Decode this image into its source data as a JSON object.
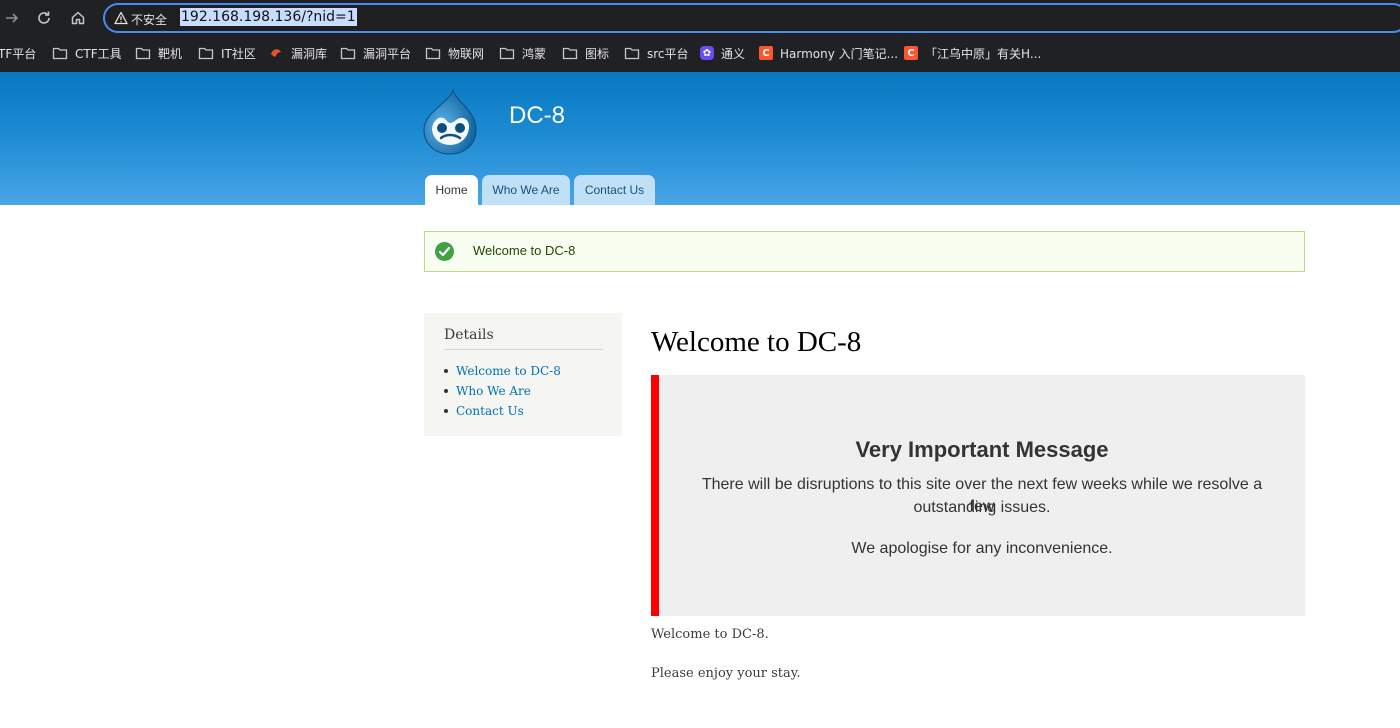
{
  "browser": {
    "security_label": "不安全",
    "url": "192.168.198.136/?nid=1",
    "bookmarks": [
      {
        "label": "TF平台",
        "icon": "none"
      },
      {
        "label": "CTF工具",
        "icon": "folder-icon"
      },
      {
        "label": "靶机",
        "icon": "folder-icon"
      },
      {
        "label": "IT社区",
        "icon": "folder-icon"
      },
      {
        "label": "漏洞库",
        "icon": "site-favicon"
      },
      {
        "label": "漏洞平台",
        "icon": "folder-icon"
      },
      {
        "label": "物联网",
        "icon": "folder-icon"
      },
      {
        "label": "鸿蒙",
        "icon": "folder-icon"
      },
      {
        "label": "图标",
        "icon": "folder-icon"
      },
      {
        "label": "src平台",
        "icon": "folder-icon"
      },
      {
        "label": "通义",
        "icon": "tongyi-icon"
      },
      {
        "label": "Harmony 入门笔记...",
        "icon": "csdn-icon"
      },
      {
        "label": "「江乌中原」有关H...",
        "icon": "csdn-icon"
      }
    ]
  },
  "site": {
    "name": "DC-8",
    "tabs": [
      "Home",
      "Who We Are",
      "Contact Us"
    ],
    "active_tab": "Home"
  },
  "status_message": "Welcome to DC-8",
  "sidebar": {
    "title": "Details",
    "links": [
      "Welcome to DC-8",
      "Who We Are",
      "Contact Us"
    ]
  },
  "main": {
    "title": "Welcome to DC-8",
    "alert": {
      "heading": "Very Important Message",
      "line1": "There will be disruptions to this site over the next few weeks while we resolve a few",
      "line2": "outstanding issues.",
      "line3": "We apologise for any inconvenience."
    },
    "para1": "Welcome to DC-8.",
    "para2": "Please enjoy your stay."
  },
  "colors": {
    "header_top": "#0779bf",
    "header_bottom": "#48a5e6",
    "alert_border": "#ff0000",
    "link": "#0071b3",
    "status_bg": "#f8fff0",
    "status_icon": "#43a047"
  }
}
